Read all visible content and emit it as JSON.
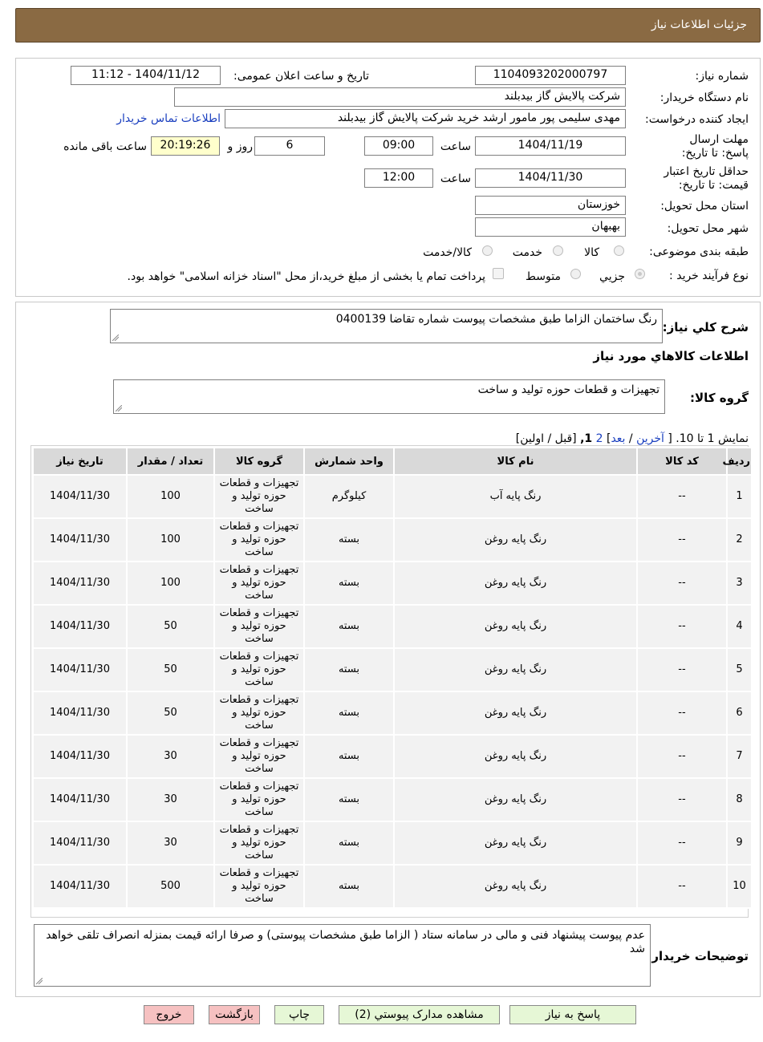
{
  "header": {
    "title": "جزئیات اطلاعات نیاز"
  },
  "form": {
    "need_number_label": "شماره نیاز:",
    "need_number": "1104093202000797",
    "announce_label": "تاریخ و ساعت اعلان عمومی:",
    "announce_value": "1404/11/12 - 11:12",
    "buyer_org_label": "نام دستگاه خریدار:",
    "buyer_org": "شرکت پالایش گاز بیدبلند",
    "requester_label": "ایجاد کننده درخواست:",
    "requester": "مهدی سلیمی پور مامور ارشد خرید شرکت پالایش گاز بیدبلند",
    "contact_link": "اطلاعات تماس خریدار",
    "deadline_label": "مهلت ارسال پاسخ: تا تاریخ:",
    "deadline_date": "1404/11/19",
    "time_label": "ساعت",
    "deadline_time": "09:00",
    "days_value": "6",
    "days_label": "روز و",
    "remaining_time": "20:19:26",
    "remaining_label": "ساعت باقی مانده",
    "validity_label": "حداقل تاریخ اعتبار قیمت: تا تاریخ:",
    "validity_date": "1404/11/30",
    "validity_time": "12:00",
    "province_label": "استان محل تحویل:",
    "province": "خوزستان",
    "city_label": "شهر محل تحویل:",
    "city": "بهبهان",
    "category_label": "طبقه بندی موضوعی:",
    "category_goods": "کالا",
    "category_service": "خدمت",
    "category_both": "کالا/خدمت",
    "process_label": "نوع فرآیند خرید :",
    "process_minor": "جزیي",
    "process_medium": "متوسط",
    "payment_note": "پرداخت تمام یا بخشی از مبلغ خرید،از محل \"اسناد خزانه اسلامی\" خواهد بود."
  },
  "summary": {
    "label": "شرح کلي نياز:",
    "value": "رنگ ساختمان  الزاما طبق مشخصات پیوست شماره تقاضا 0400139"
  },
  "goods_section": {
    "title": "اطلاعات کالاهاي مورد نياز",
    "group_label": "گروه کالا:",
    "group_value": "تجهیزات و قطعات حوزه تولید و ساخت"
  },
  "pagination": {
    "prefix": "نمایش 1 تا 10. [",
    "last": "آخرين",
    "sep1": "/",
    "next": "بعد",
    "page2": "2",
    "page1": "1,",
    "suffix": "[قبل / اولين]"
  },
  "table": {
    "headers": [
      "رديف",
      "کد کالا",
      "نام کالا",
      "واحد شمارش",
      "گروه کالا",
      "تعداد / مقدار",
      "تاريخ نياز"
    ],
    "rows": [
      [
        "1",
        "--",
        "رنگ پایه آب",
        "کیلوگرم",
        "تجهیزات و قطعات حوزه تولید و ساخت",
        "100",
        "1404/11/30"
      ],
      [
        "2",
        "--",
        "رنگ پایه روغن",
        "بسته",
        "تجهیزات و قطعات حوزه تولید و ساخت",
        "100",
        "1404/11/30"
      ],
      [
        "3",
        "--",
        "رنگ پایه روغن",
        "بسته",
        "تجهیزات و قطعات حوزه تولید و ساخت",
        "100",
        "1404/11/30"
      ],
      [
        "4",
        "--",
        "رنگ پایه روغن",
        "بسته",
        "تجهیزات و قطعات حوزه تولید و ساخت",
        "50",
        "1404/11/30"
      ],
      [
        "5",
        "--",
        "رنگ پایه روغن",
        "بسته",
        "تجهیزات و قطعات حوزه تولید و ساخت",
        "50",
        "1404/11/30"
      ],
      [
        "6",
        "--",
        "رنگ پایه روغن",
        "بسته",
        "تجهیزات و قطعات حوزه تولید و ساخت",
        "50",
        "1404/11/30"
      ],
      [
        "7",
        "--",
        "رنگ پایه روغن",
        "بسته",
        "تجهیزات و قطعات حوزه تولید و ساخت",
        "30",
        "1404/11/30"
      ],
      [
        "8",
        "--",
        "رنگ پایه روغن",
        "بسته",
        "تجهیزات و قطعات حوزه تولید و ساخت",
        "30",
        "1404/11/30"
      ],
      [
        "9",
        "--",
        "رنگ پایه روغن",
        "بسته",
        "تجهیزات و قطعات حوزه تولید و ساخت",
        "30",
        "1404/11/30"
      ],
      [
        "10",
        "--",
        "رنگ پایه روغن",
        "بسته",
        "تجهیزات و قطعات حوزه تولید و ساخت",
        "500",
        "1404/11/30"
      ]
    ]
  },
  "buyer_notes": {
    "label": "توضیحات خریدار:",
    "value": "عدم پیوست پیشنهاد فنی و مالی در سامانه ستاد ( الزاما طبق مشخصات پیوستی)  و صرفا ارائه قیمت بمنزله انصراف تلقی خواهد شد"
  },
  "buttons": {
    "reply": "پاسخ به نیاز",
    "attachments": "مشاهده مدارک پیوستي (2)",
    "print": "چاپ",
    "back": "بازگشت",
    "exit": "خروج"
  },
  "colors": {
    "header_bg": "#8a6a43",
    "time_highlight": "#ffffcc",
    "link": "#1a3fbf",
    "back_button": "#f6c1c1",
    "exit_button": "#f6c1c1",
    "green_button": "#e6f7d6"
  }
}
